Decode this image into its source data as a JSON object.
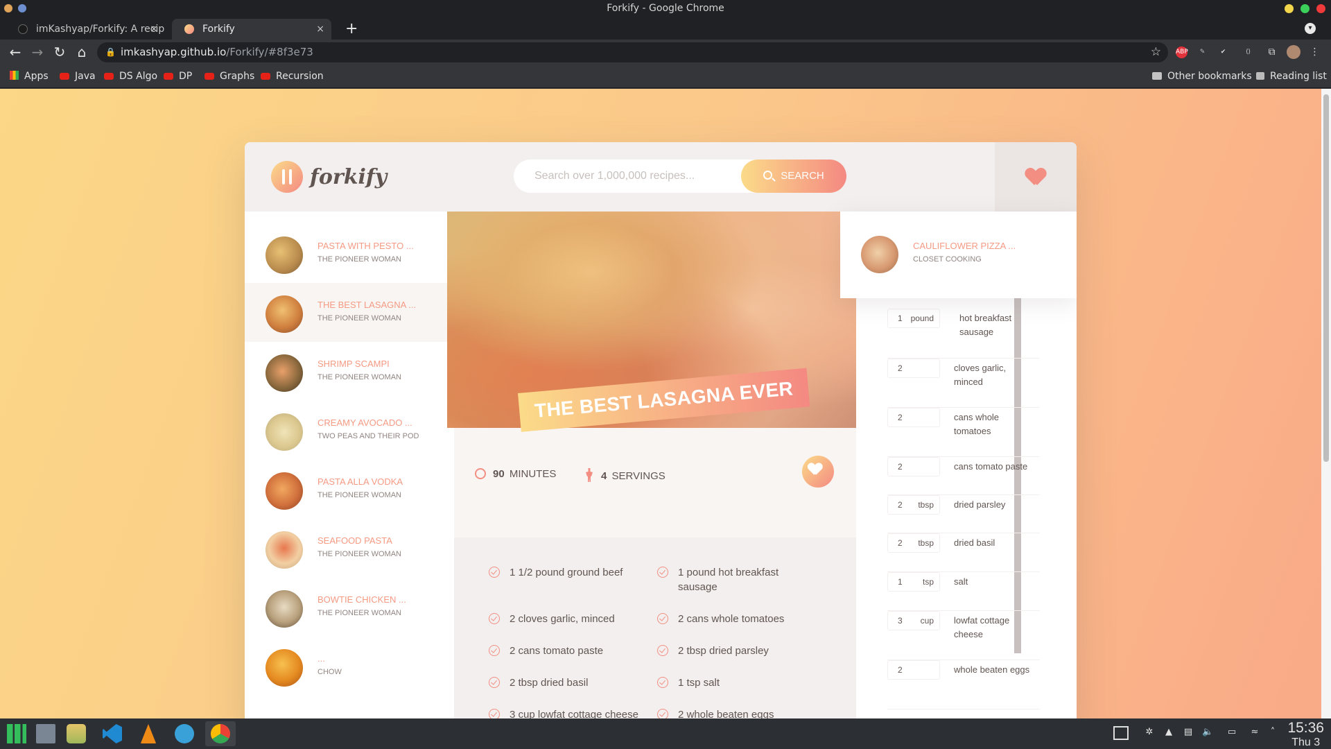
{
  "window": {
    "title": "Forkify - Google Chrome"
  },
  "tabs": [
    {
      "label": "imKashyap/Forkify: A recipe a",
      "close": "×"
    },
    {
      "label": "Forkify",
      "close": "×"
    }
  ],
  "new_tab": "+",
  "omnibox": {
    "host": "imkashyap.github.io",
    "path": "/Forkify/#8f3e73"
  },
  "bookmarks_bar": {
    "items": [
      "Apps",
      "Java",
      "DS Algo",
      "DP",
      "Graphs",
      "Recursion"
    ],
    "other": "Other bookmarks",
    "reading_list": "Reading list"
  },
  "app": {
    "logo_text": "forkify",
    "search_placeholder": "Search over 1,000,000 recipes...",
    "search_button": "SEARCH",
    "results": [
      {
        "title": "PASTA WITH PESTO ...",
        "publisher": "THE PIONEER WOMAN",
        "active": false
      },
      {
        "title": "THE BEST LASAGNA ...",
        "publisher": "THE PIONEER WOMAN",
        "active": true
      },
      {
        "title": "SHRIMP SCAMPI",
        "publisher": "THE PIONEER WOMAN",
        "active": false
      },
      {
        "title": "CREAMY AVOCADO ...",
        "publisher": "TWO PEAS AND THEIR POD",
        "active": false
      },
      {
        "title": "PASTA ALLA VODKA",
        "publisher": "THE PIONEER WOMAN",
        "active": false
      },
      {
        "title": "SEAFOOD PASTA",
        "publisher": "THE PIONEER WOMAN",
        "active": false
      },
      {
        "title": "BOWTIE CHICKEN ...",
        "publisher": "THE PIONEER WOMAN",
        "active": false
      },
      {
        "title": "...",
        "publisher": "CHOW",
        "active": false
      }
    ],
    "recipe": {
      "title": "THE BEST LASAGNA EVER",
      "minutes": "90",
      "minutes_label": "MINUTES",
      "servings": "4",
      "servings_label": "SERVINGS",
      "ingredients_col1": [
        "1 1/2 pound ground beef",
        "2 cloves garlic, minced",
        "2 cans tomato paste",
        "2 tbsp dried basil",
        "3 cup lowfat cottage cheese"
      ],
      "ingredients_col2": [
        "1 pound hot breakfast sausage",
        "2 cans whole tomatoes",
        "2 tbsp dried parsley",
        "1 tsp salt",
        "2 whole beaten eggs"
      ]
    },
    "bookmark_dropdown": {
      "title": "CAULIFLOWER PIZZA ...",
      "publisher": "CLOSET COOKING"
    },
    "shopping_list": [
      {
        "count": "1",
        "unit": "pound",
        "desc": "hot breakfast sausage"
      },
      {
        "count": "2",
        "unit": "",
        "desc": "cloves garlic, minced"
      },
      {
        "count": "2",
        "unit": "",
        "desc": "cans whole tomatoes"
      },
      {
        "count": "2",
        "unit": "",
        "desc": "cans tomato paste"
      },
      {
        "count": "2",
        "unit": "tbsp",
        "desc": "dried parsley"
      },
      {
        "count": "2",
        "unit": "tbsp",
        "desc": "dried basil"
      },
      {
        "count": "1",
        "unit": "tsp",
        "desc": "salt"
      },
      {
        "count": "3",
        "unit": "cup",
        "desc": "lowfat cottage cheese"
      },
      {
        "count": "2",
        "unit": "",
        "desc": "whole beaten eggs"
      }
    ]
  },
  "taskbar": {
    "time": "15:36",
    "day": "Thu 3"
  },
  "colors": {
    "brand_gradient_start": "#fbdb89",
    "brand_gradient_end": "#f48982",
    "accent": "#f38e82",
    "text": "#615551"
  }
}
